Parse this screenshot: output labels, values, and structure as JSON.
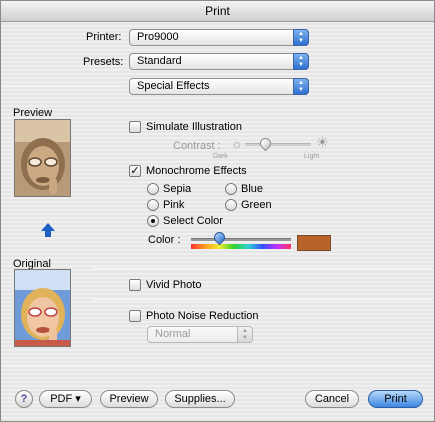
{
  "window": {
    "title": "Print"
  },
  "printer": {
    "label": "Printer:",
    "value": "Pro9000"
  },
  "presets": {
    "label": "Presets:",
    "value": "Standard"
  },
  "panel": {
    "value": "Special Effects"
  },
  "preview": {
    "label": "Preview"
  },
  "original": {
    "label": "Original"
  },
  "simulate": {
    "label": "Simulate Illustration",
    "checked": false
  },
  "contrast": {
    "label": "Contrast :",
    "dark": "Dark",
    "light": "Light",
    "level": 0.3
  },
  "monochrome": {
    "label": "Monochrome Effects",
    "checked": true
  },
  "radios": {
    "sepia": "Sepia",
    "blue": "Blue",
    "pink": "Pink",
    "green": "Green",
    "select_color": "Select Color",
    "selected": "select_color"
  },
  "color": {
    "label": "Color :",
    "swatch": "#b8632a",
    "level": 0.28
  },
  "vivid": {
    "label": "Vivid Photo",
    "checked": false
  },
  "noise": {
    "label": "Photo Noise Reduction",
    "checked": false,
    "level": "Normal"
  },
  "footer": {
    "help": "?",
    "pdf": "PDF ▾",
    "preview": "Preview",
    "supplies": "Supplies...",
    "cancel": "Cancel",
    "print": "Print"
  }
}
